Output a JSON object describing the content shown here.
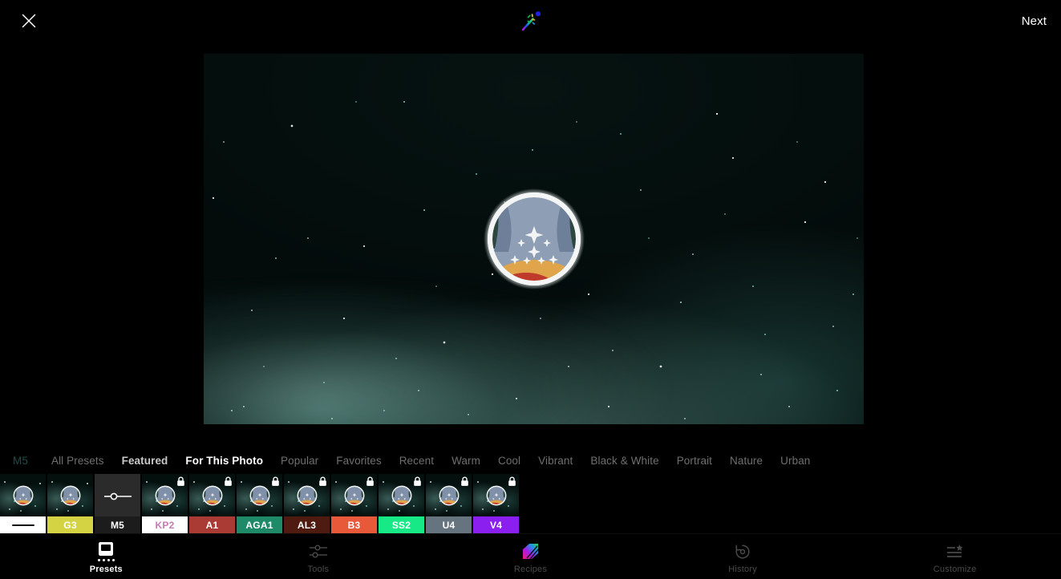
{
  "topbar": {
    "close_label": "close",
    "close_icon": "close-x-icon",
    "magic_icon": "magic-wand-icon",
    "next_label": "Next"
  },
  "photo": {
    "alt": "Night sky milky way photograph with circular star badge sticker",
    "badge_icon": "circular-star-badge"
  },
  "categories": {
    "items": [
      {
        "label": "M5",
        "state": "code"
      },
      {
        "label": "All Presets",
        "state": "normal"
      },
      {
        "label": "Featured",
        "state": "featured"
      },
      {
        "label": "For This Photo",
        "state": "active"
      },
      {
        "label": "Popular",
        "state": "normal"
      },
      {
        "label": "Favorites",
        "state": "normal"
      },
      {
        "label": "Recent",
        "state": "normal"
      },
      {
        "label": "Warm",
        "state": "normal"
      },
      {
        "label": "Cool",
        "state": "normal"
      },
      {
        "label": "Vibrant",
        "state": "normal"
      },
      {
        "label": "Black & White",
        "state": "normal"
      },
      {
        "label": "Portrait",
        "state": "normal"
      },
      {
        "label": "Nature",
        "state": "normal"
      },
      {
        "label": "Urban",
        "state": "normal"
      }
    ]
  },
  "presets": {
    "items": [
      {
        "label": "",
        "bg": "#ffffff",
        "fg": "#0d0d0d",
        "locked": false,
        "selected": false,
        "kind": "none"
      },
      {
        "label": "G3",
        "bg": "#d4d343",
        "fg": "#ffffff",
        "locked": false,
        "selected": false,
        "kind": "preset"
      },
      {
        "label": "M5",
        "bg": "#1c1c1c",
        "fg": "#ffffff",
        "locked": false,
        "selected": true,
        "kind": "adjust"
      },
      {
        "label": "KP2",
        "bg": "#ffffff",
        "fg": "#c77ab4",
        "locked": true,
        "selected": false,
        "kind": "preset"
      },
      {
        "label": "A1",
        "bg": "#a93a34",
        "fg": "#ffffff",
        "locked": true,
        "selected": false,
        "kind": "preset"
      },
      {
        "label": "AGA1",
        "bg": "#1f8a68",
        "fg": "#ffffff",
        "locked": true,
        "selected": false,
        "kind": "preset"
      },
      {
        "label": "AL3",
        "bg": "#4f1a10",
        "fg": "#ffffff",
        "locked": true,
        "selected": false,
        "kind": "preset"
      },
      {
        "label": "B3",
        "bg": "#e8593a",
        "fg": "#ffffff",
        "locked": true,
        "selected": false,
        "kind": "preset"
      },
      {
        "label": "SS2",
        "bg": "#16e986",
        "fg": "#ffffff",
        "locked": true,
        "selected": false,
        "kind": "preset"
      },
      {
        "label": "U4",
        "bg": "#667480",
        "fg": "#ffffff",
        "locked": true,
        "selected": false,
        "kind": "preset"
      },
      {
        "label": "V4",
        "bg": "#8a1ff0",
        "fg": "#ffffff",
        "locked": true,
        "selected": false,
        "kind": "preset"
      }
    ],
    "lock_icon": "lock-icon"
  },
  "bottomnav": {
    "items": [
      {
        "label": "Presets",
        "icon": "presets-icon",
        "active": true
      },
      {
        "label": "Tools",
        "icon": "sliders-icon",
        "active": false
      },
      {
        "label": "Recipes",
        "icon": "recipes-icon",
        "active": false
      },
      {
        "label": "History",
        "icon": "history-icon",
        "active": false
      },
      {
        "label": "Customize",
        "icon": "customize-icon",
        "active": false
      }
    ]
  },
  "colors": {
    "background": "#000000",
    "active_text": "#ffffff",
    "inactive_text": "#6f6f6f",
    "code_text": "#1f4c49"
  }
}
